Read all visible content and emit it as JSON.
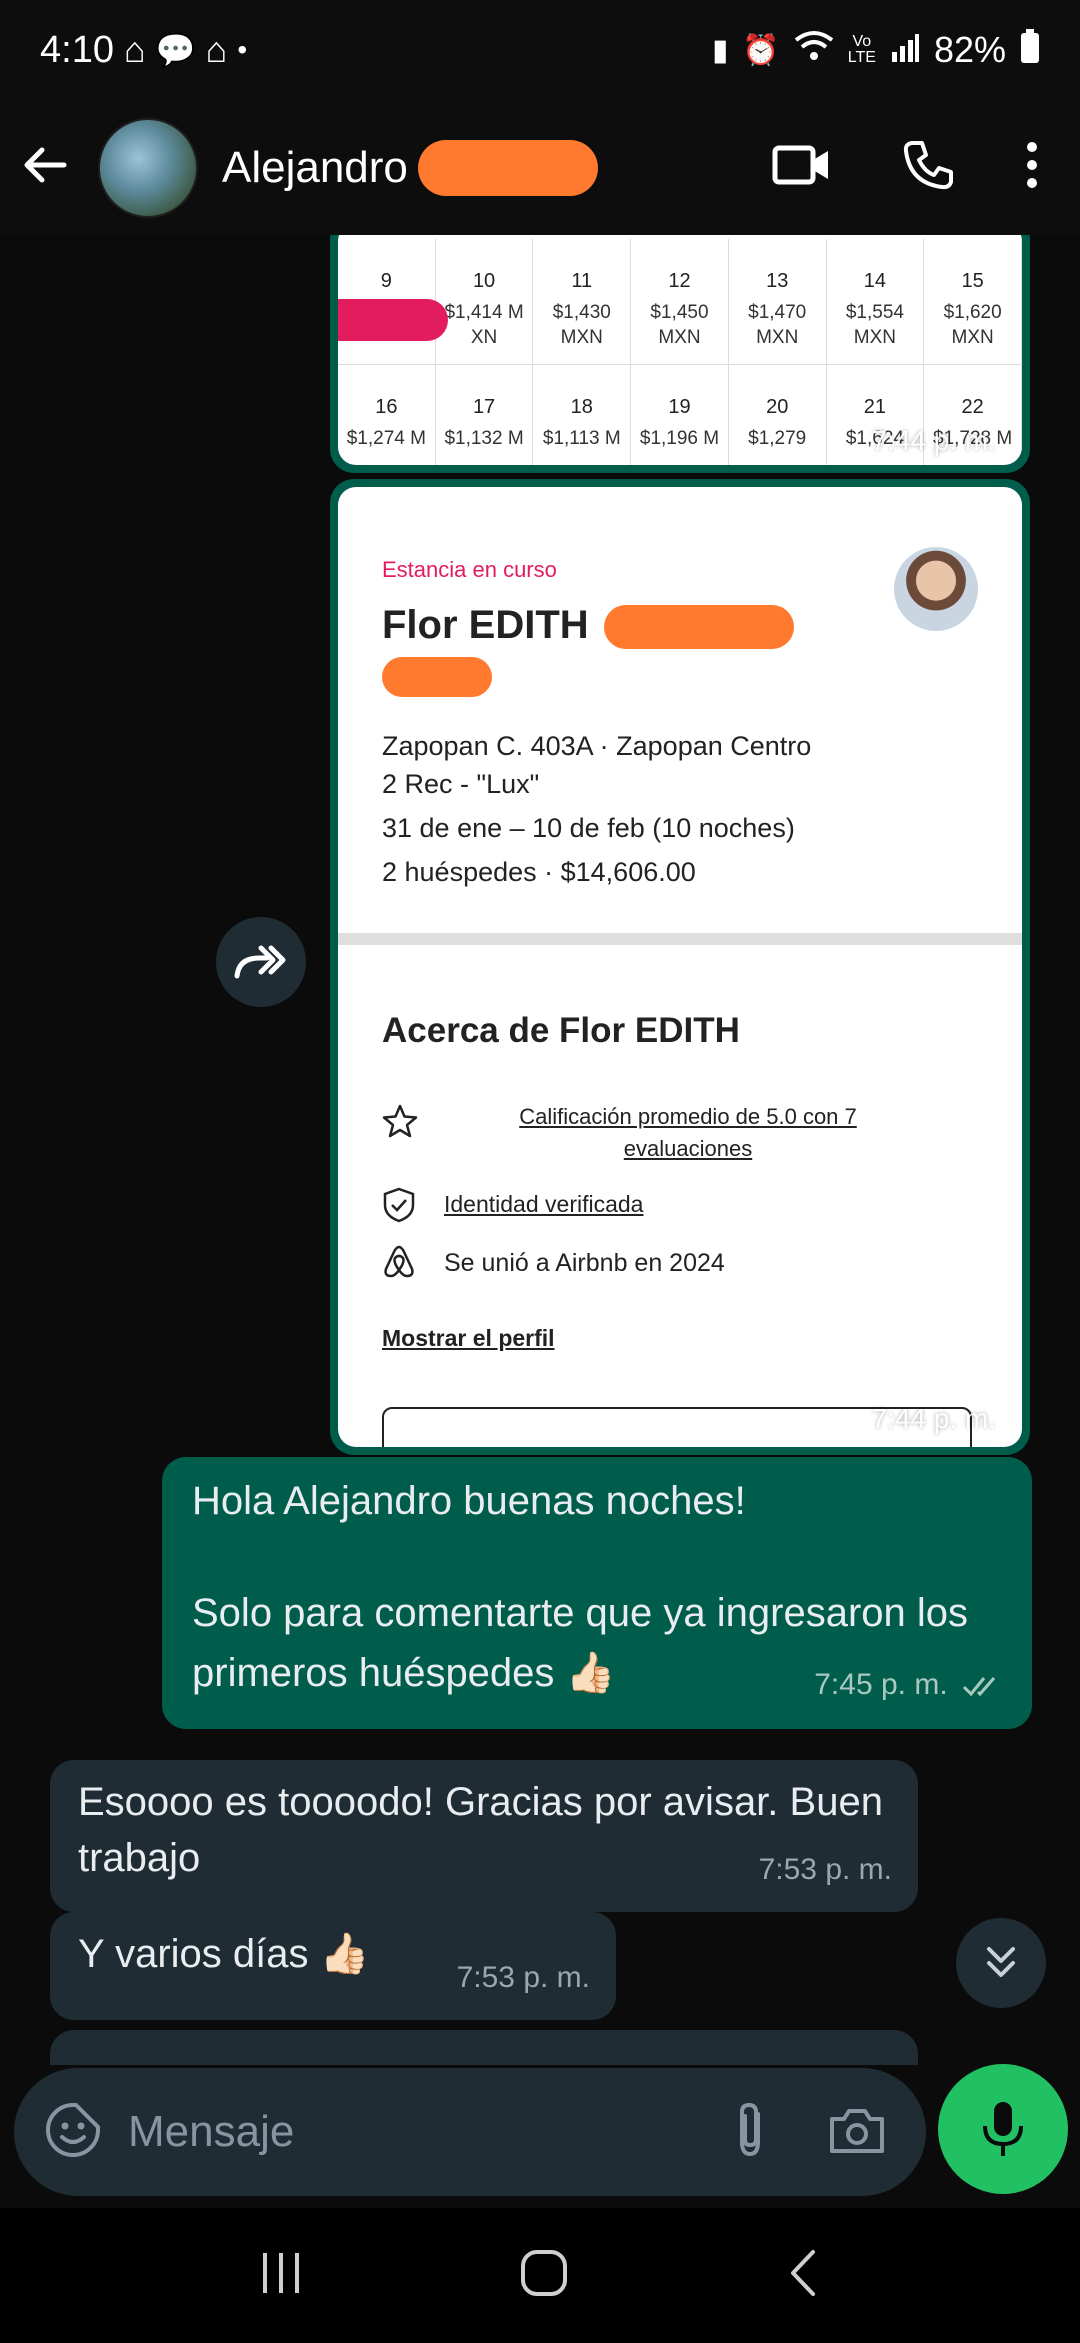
{
  "status_bar": {
    "time": "4:10",
    "battery": "82%"
  },
  "header": {
    "contact_name": "Alejandro"
  },
  "calendar": {
    "row1": [
      {
        "day": "9",
        "price": "",
        "cur": ""
      },
      {
        "day": "10",
        "price": "$1,414 M",
        "cur": "XN"
      },
      {
        "day": "11",
        "price": "$1,430",
        "cur": "MXN"
      },
      {
        "day": "12",
        "price": "$1,450",
        "cur": "MXN"
      },
      {
        "day": "13",
        "price": "$1,470",
        "cur": "MXN"
      },
      {
        "day": "14",
        "price": "$1,554",
        "cur": "MXN"
      },
      {
        "day": "15",
        "price": "$1,620",
        "cur": "MXN"
      }
    ],
    "row2": [
      {
        "day": "16",
        "price": "$1,274 M"
      },
      {
        "day": "17",
        "price": "$1,132 M"
      },
      {
        "day": "18",
        "price": "$1,113 M"
      },
      {
        "day": "19",
        "price": "$1,196 M"
      },
      {
        "day": "20",
        "price": "$1,279"
      },
      {
        "day": "21",
        "price": "$1,624"
      },
      {
        "day": "22",
        "price": "$1,728 M"
      }
    ],
    "time": "7:44 p. m."
  },
  "stay_card": {
    "label": "Estancia en curso",
    "host_name": "Flor EDITH",
    "address": "Zapopan C. 403A · Zapopan Centro",
    "unit": "2 Rec - \"Lux\"",
    "dates": "31 de ene – 10 de feb (10 noches)",
    "guests": "2 huéspedes · $14,606.00",
    "about_title": "Acerca de Flor EDITH",
    "rating": "Calificación promedio de 5.0 con 7 evaluaciones",
    "identity": "Identidad verificada",
    "joined": "Se unió a Airbnb en 2024",
    "profile_link": "Mostrar el perfil",
    "time": "7:44 p. m."
  },
  "messages": [
    {
      "text1": "Hola Alejandro buenas noches!",
      "text2": "Solo para comentarte que ya ingresaron los primeros huéspedes 👍🏻",
      "time": "7:45 p. m."
    },
    {
      "text": "Esoooo es toooodo! Gracias por avisar. Buen trabajo",
      "time": "7:53 p. m."
    },
    {
      "text": "Y varios días 👍🏻",
      "time": "7:53 p. m."
    }
  ],
  "composer": {
    "placeholder": "Mensaje"
  }
}
